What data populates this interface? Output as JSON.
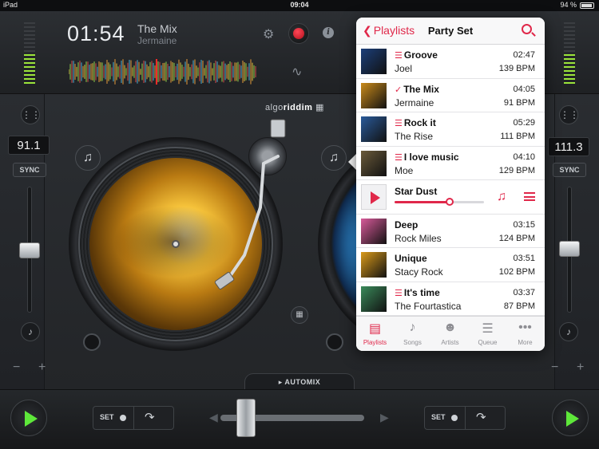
{
  "status": {
    "device": "iPad",
    "time": "09:04",
    "battery": "94 %"
  },
  "deck_a": {
    "elapsed": "01:54",
    "title": "The Mix",
    "artist": "Jermaine",
    "pitch": "91.1",
    "sync_label": "SYNC"
  },
  "deck_b": {
    "pitch": "111.3",
    "sync_label": "SYNC"
  },
  "brand": {
    "prefix": "algo",
    "bold": "riddim"
  },
  "automix_label": "AUTOMIX",
  "bottom": {
    "set_label": "SET"
  },
  "playlist": {
    "back_label": "Playlists",
    "title": "Party Set",
    "rows": [
      {
        "title": "Groove",
        "artist": "Joel",
        "duration": "02:47",
        "bpm": "139 BPM",
        "marker": "list",
        "art": "#1c3f7a"
      },
      {
        "title": "The Mix",
        "artist": "Jermaine",
        "duration": "04:05",
        "bpm": "91 BPM",
        "marker": "check",
        "art": "#c98a1a"
      },
      {
        "title": "Rock it",
        "artist": "The Rise",
        "duration": "05:29",
        "bpm": "111 BPM",
        "marker": "list",
        "art": "#2a5a9a"
      },
      {
        "title": "I love music",
        "artist": "Moe",
        "duration": "04:10",
        "bpm": "129 BPM",
        "marker": "list",
        "art": "#6a5a3a"
      }
    ],
    "now_playing": {
      "title": "Star Dust",
      "progress": 0.62
    },
    "rows_after": [
      {
        "title": "Deep",
        "artist": "Rock Miles",
        "duration": "03:15",
        "bpm": "124 BPM",
        "marker": "none",
        "art": "#d85a9a"
      },
      {
        "title": "Unique",
        "artist": "Stacy Rock",
        "duration": "03:51",
        "bpm": "102 BPM",
        "marker": "none",
        "art": "#d99a1a"
      },
      {
        "title": "It's time",
        "artist": "The Fourtastica",
        "duration": "03:37",
        "bpm": "87 BPM",
        "marker": "list",
        "art": "#3a8a5a"
      }
    ],
    "tabs": [
      {
        "label": "Playlists",
        "icon": "playlists-icon",
        "active": true
      },
      {
        "label": "Songs",
        "icon": "music-note-icon",
        "active": false
      },
      {
        "label": "Artists",
        "icon": "artist-icon",
        "active": false
      },
      {
        "label": "Queue",
        "icon": "queue-icon",
        "active": false
      },
      {
        "label": "More",
        "icon": "more-icon",
        "active": false
      }
    ]
  },
  "colors": {
    "accent": "#e0284a",
    "play_green": "#5ee83a",
    "vu_green": "#9be43a"
  }
}
